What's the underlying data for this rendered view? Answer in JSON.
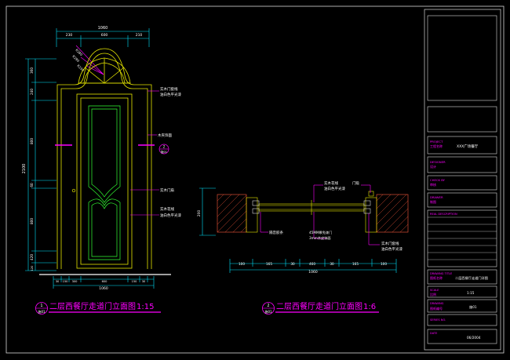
{
  "colors": {
    "background": "#000000",
    "frame": "#d9d9d9",
    "dimension": "#00e5ff",
    "accent": "#ff00ff",
    "door_line": "#e6e600",
    "hatch": "#ff5a3c",
    "text_white": "#ffffff",
    "green": "#33ff33"
  },
  "elevation": {
    "top_dims": [
      "1060",
      "230",
      "600",
      "210"
    ],
    "arch_dims": [
      "R280",
      "R290",
      "R230"
    ],
    "left_dims": [
      "2100",
      "360",
      "240",
      "800",
      "60",
      "800",
      "420",
      "120"
    ],
    "bottom_dims": [
      "1060",
      "30",
      "150",
      "300",
      "600",
      "150",
      "30"
    ],
    "labels": [
      "实木门套线",
      "油白色平光漆",
      "木夹饰面",
      "实木门扇",
      "实木花线",
      "油白色平光漆"
    ],
    "section_marker_top": "2",
    "section_marker_bottom": "施01",
    "title_marker_top": "1",
    "title_marker_bottom": "施01",
    "title": "二层西餐厅走道门立面图",
    "scale": "1:15"
  },
  "plan": {
    "left_dim": "200",
    "top_labels": [
      "实木花线",
      "油白色平光漆",
      "门吸"
    ],
    "bottom_labels": [
      "隔音胶条",
      "45MM厚免漆门",
      "3mm木皮饰面",
      "实木门套线",
      "油白色平光漆"
    ],
    "bottom_dims": [
      "100",
      "165",
      "30",
      "460",
      "30",
      "165",
      "100"
    ],
    "total_dim": "1060",
    "title_marker_top": "2",
    "title_marker_bottom": "施01",
    "title": "二层西餐厅走道门立面图",
    "scale": "1:6"
  },
  "title_block": {
    "project_label_en": "PROJECT",
    "project_label_cn": "工程名称",
    "project_value": "XXX广场餐厅",
    "designer_label_en": "DESIGNER",
    "designer_label_cn": "设计",
    "check_label_en": "CHECK BY",
    "check_label_cn": "审核",
    "drawn_label_en": "DRAWER",
    "drawn_label_cn": "制图",
    "desc_label": "REAL DESCRIPTION",
    "drawing_title_en": "DRAWING TITLE",
    "drawing_title_cn": "图纸名称",
    "drawing_title_value": "二层西餐厅走道门详图",
    "scale_label_en": "SCALE",
    "scale_label_cn": "比例",
    "scale_value": "1:15",
    "drawing_no_label_en": "DRAWING",
    "drawing_no_label_cn": "图纸编号",
    "drawing_no_value": "施01",
    "series_label": "SERIES NO.",
    "date_label": "DATE",
    "date_value": "06/2004"
  }
}
